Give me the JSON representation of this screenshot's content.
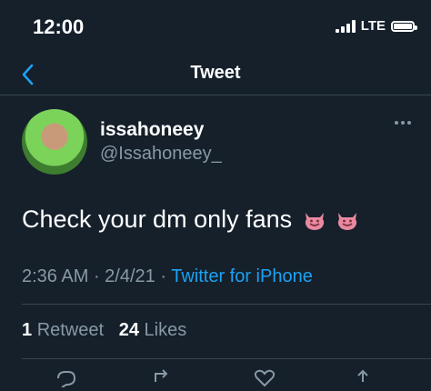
{
  "status_bar": {
    "time": "12:00",
    "network": "LTE"
  },
  "nav": {
    "title": "Tweet",
    "back_icon": "chevron-left-icon"
  },
  "tweet": {
    "author_name": "issahoneey",
    "author_handle": "@Issahoneey_",
    "text": "Check your dm only fans",
    "emojis": [
      "smiling-imp-emoji",
      "smiling-imp-emoji"
    ],
    "time": "2:36 AM",
    "date": "2/4/21",
    "source": "Twitter for iPhone"
  },
  "stats": {
    "retweet_count": "1",
    "retweet_label": "Retweet",
    "like_count": "24",
    "like_label": "Likes"
  },
  "colors": {
    "background": "#15202b",
    "accent": "#1da1f2",
    "secondary_text": "#8899a6",
    "divider": "#38444d"
  }
}
